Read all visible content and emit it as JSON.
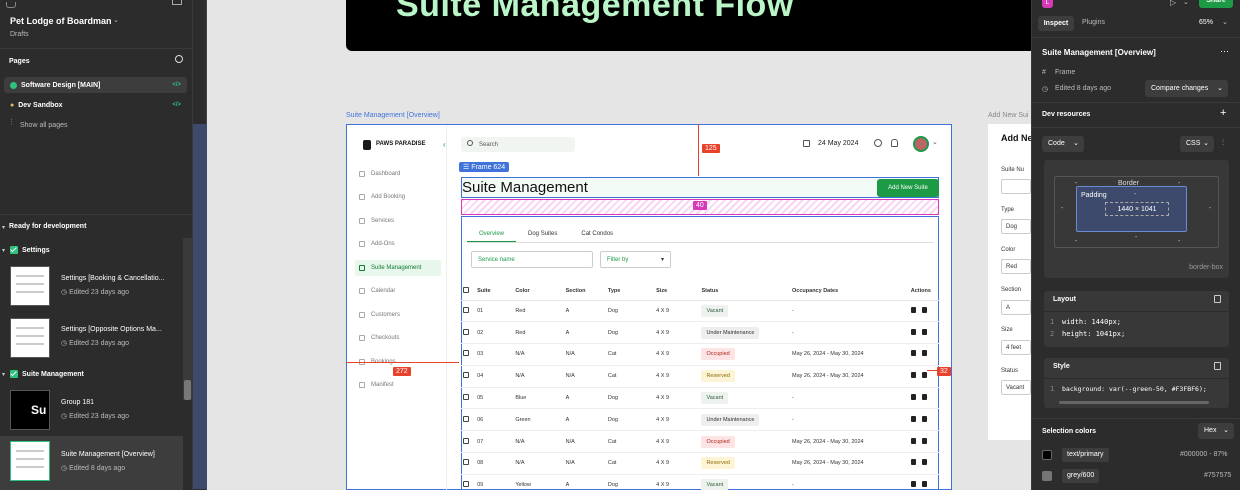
{
  "left": {
    "project": "Pet Lodge of Boardman",
    "subtitle": "Drafts",
    "pages_title": "Pages",
    "pages": [
      {
        "label": "Software Design [MAIN]"
      },
      {
        "label": "Dev Sandbox"
      }
    ],
    "show_all": "Show all pages",
    "ready_title": "Ready for development",
    "group1": "Settings",
    "items1": [
      {
        "title": "Settings [Booking & Cancellatio...",
        "meta": "Edited 23 days ago"
      },
      {
        "title": "Settings [Opposite Options Ma...",
        "meta": "Edited 23 days ago"
      }
    ],
    "group2": "Suite Management",
    "items2": [
      {
        "title": "Group 181",
        "meta": "Edited 23 days ago"
      },
      {
        "title": "Suite Management [Overview]",
        "meta": "Edited 8 days ago"
      }
    ]
  },
  "canvas": {
    "banner": "Suite Management Flow",
    "frame_label": "Suite Management [Overview]",
    "frame2_label": "Add New Sui",
    "frame624": "Frame 624",
    "m125": "125",
    "m40": "40",
    "m272": "272",
    "m32": "32",
    "app": {
      "brand": "PAWS PARADISE",
      "search": "Search",
      "date": "24 May 2024",
      "nav": [
        "Dashboard",
        "Add Booking",
        "Services",
        "Add-Ons",
        "Suite Management",
        "Calendar",
        "Customers",
        "Checkouts",
        "Bookings",
        "Manifest"
      ],
      "title": "Suite Management",
      "add_btn": "Add New Suite",
      "tabs": [
        "Overview",
        "Dog Suites",
        "Cat Condos"
      ],
      "service_placeholder": "Service name",
      "filter": "Filter by",
      "headers": [
        "Suite",
        "Color",
        "Section",
        "Type",
        "Size",
        "Status",
        "Occupancy Dates",
        "Actions"
      ],
      "rows": [
        {
          "suite": "01",
          "color": "Red",
          "section": "A",
          "type": "Dog",
          "size": "4 X 9",
          "status": "Vacant",
          "dates": "-"
        },
        {
          "suite": "02",
          "color": "Red",
          "section": "A",
          "type": "Dog",
          "size": "4 X 9",
          "status": "Under Maintenance",
          "dates": "-"
        },
        {
          "suite": "03",
          "color": "N/A",
          "section": "N/A",
          "type": "Cat",
          "size": "4 X 9",
          "status": "Occupied",
          "dates": "May 26, 2024 - May 30, 2024"
        },
        {
          "suite": "04",
          "color": "N/A",
          "section": "N/A",
          "type": "Cat",
          "size": "4 X 9",
          "status": "Reserved",
          "dates": "May 26, 2024 - May 30, 2024"
        },
        {
          "suite": "05",
          "color": "Blue",
          "section": "A",
          "type": "Dog",
          "size": "4 X 9",
          "status": "Vacant",
          "dates": "-"
        },
        {
          "suite": "06",
          "color": "Green",
          "section": "A",
          "type": "Dog",
          "size": "4 X 9",
          "status": "Under Maintenance",
          "dates": "-"
        },
        {
          "suite": "07",
          "color": "N/A",
          "section": "N/A",
          "type": "Cat",
          "size": "4 X 9",
          "status": "Occupied",
          "dates": "May 26, 2024 - May 30, 2024"
        },
        {
          "suite": "08",
          "color": "N/A",
          "section": "N/A",
          "type": "Cat",
          "size": "4 X 9",
          "status": "Reserved",
          "dates": "May 26, 2024 - May 30, 2024"
        },
        {
          "suite": "09",
          "color": "Yellow",
          "section": "A",
          "type": "Dog",
          "size": "4 X 9",
          "status": "Vacant",
          "dates": "-"
        }
      ]
    },
    "form": {
      "title": "Add Ne",
      "labels": [
        "Suite Nu",
        "Type",
        "Color",
        "Section",
        "Size",
        "Status"
      ],
      "values": [
        "",
        "Dog",
        "Red",
        "A",
        "4 feet",
        "Vacant"
      ]
    }
  },
  "right": {
    "share": "Share",
    "tab_inspect": "Inspect",
    "tab_plugins": "Plugins",
    "zoom": "65%",
    "selected": "Suite Management [Overview]",
    "type": "Frame",
    "edited": "Edited 8 days ago",
    "compare": "Compare changes",
    "dev_resources": "Dev resources",
    "code_select": "Code",
    "lang_select": "CSS",
    "box_border": "Border",
    "box_padding": "Padding",
    "box_size": "1440 × 1041",
    "box_dash": "-",
    "box_type": "border-box",
    "layout_title": "Layout",
    "layout_lines": [
      {
        "n": "1",
        "text": "width: 1440px;"
      },
      {
        "n": "2",
        "text": "height: 1041px;"
      }
    ],
    "style_title": "Style",
    "style_line": {
      "n": "1",
      "text": "background: var(--green-50, #F3FBF6);"
    },
    "selection_colors": "Selection colors",
    "hex": "Hex",
    "colors": [
      {
        "name": "text/primary",
        "value": "#000000 - 87%",
        "swatch": "#000000"
      },
      {
        "name": "grey/600",
        "value": "#757575",
        "swatch": "#757575"
      }
    ]
  }
}
